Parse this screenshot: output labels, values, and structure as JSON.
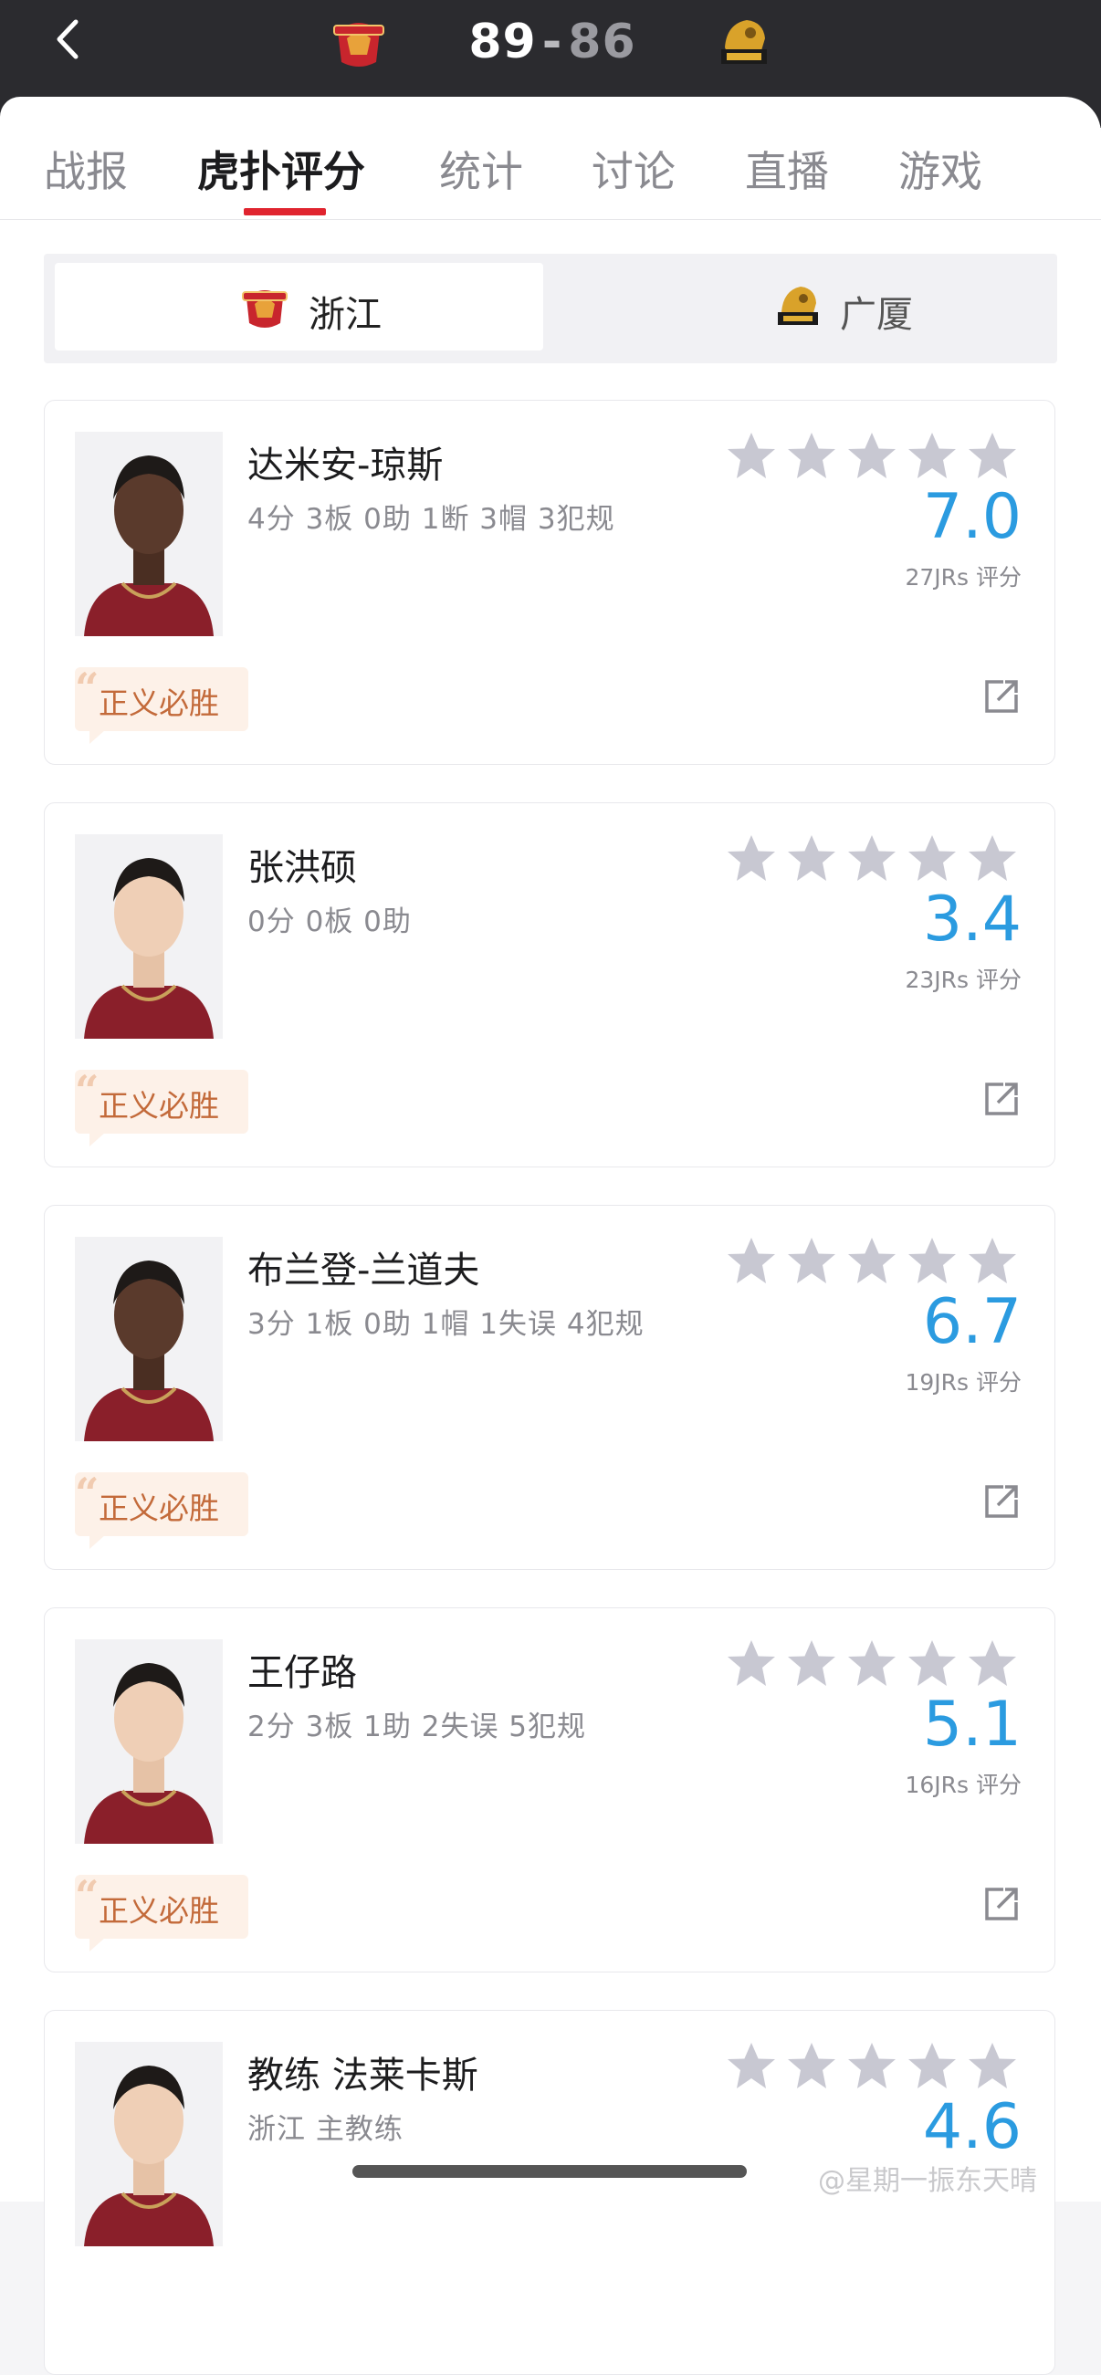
{
  "header": {
    "home_score": "89",
    "separator": "-",
    "away_score": "86",
    "home_logo": "guangsha-lion-logo",
    "away_logo": "zhejiang-bull-logo"
  },
  "tabs": [
    {
      "label": "战报"
    },
    {
      "label": "虎扑评分",
      "active": true
    },
    {
      "label": "统计"
    },
    {
      "label": "讨论"
    },
    {
      "label": "直播"
    },
    {
      "label": "游戏"
    }
  ],
  "team_switch": {
    "selected": {
      "name": "浙江"
    },
    "other": {
      "name": "广厦"
    }
  },
  "players": [
    {
      "name": "达米安-琼斯",
      "stats": "4分 3板 0助 1断 3帽 3犯规",
      "score": "7.0",
      "votes": "27JRs 评分",
      "tag": "正义必胜"
    },
    {
      "name": "张洪硕",
      "stats": "0分 0板 0助",
      "score": "3.4",
      "votes": "23JRs 评分",
      "tag": "正义必胜"
    },
    {
      "name": "布兰登-兰道夫",
      "stats": "3分 1板 0助 1帽 1失误 4犯规",
      "score": "6.7",
      "votes": "19JRs 评分",
      "tag": "正义必胜"
    },
    {
      "name": "王仔路",
      "stats": "2分 3板 1助 2失误 5犯规",
      "score": "5.1",
      "votes": "16JRs 评分",
      "tag": "正义必胜"
    },
    {
      "name": "教练 法莱卡斯",
      "stats": "浙江 主教练",
      "score": "4.6",
      "votes": "",
      "tag": ""
    }
  ],
  "watermark": "@星期一振东天晴",
  "colors": {
    "header_bg": "#2b2b2f",
    "accent_red": "#e0242f",
    "score_blue": "#2b9be0",
    "star_gray": "#c8c8d2",
    "tag_bg": "#fdf1e8",
    "tag_text": "#c36a3a"
  }
}
